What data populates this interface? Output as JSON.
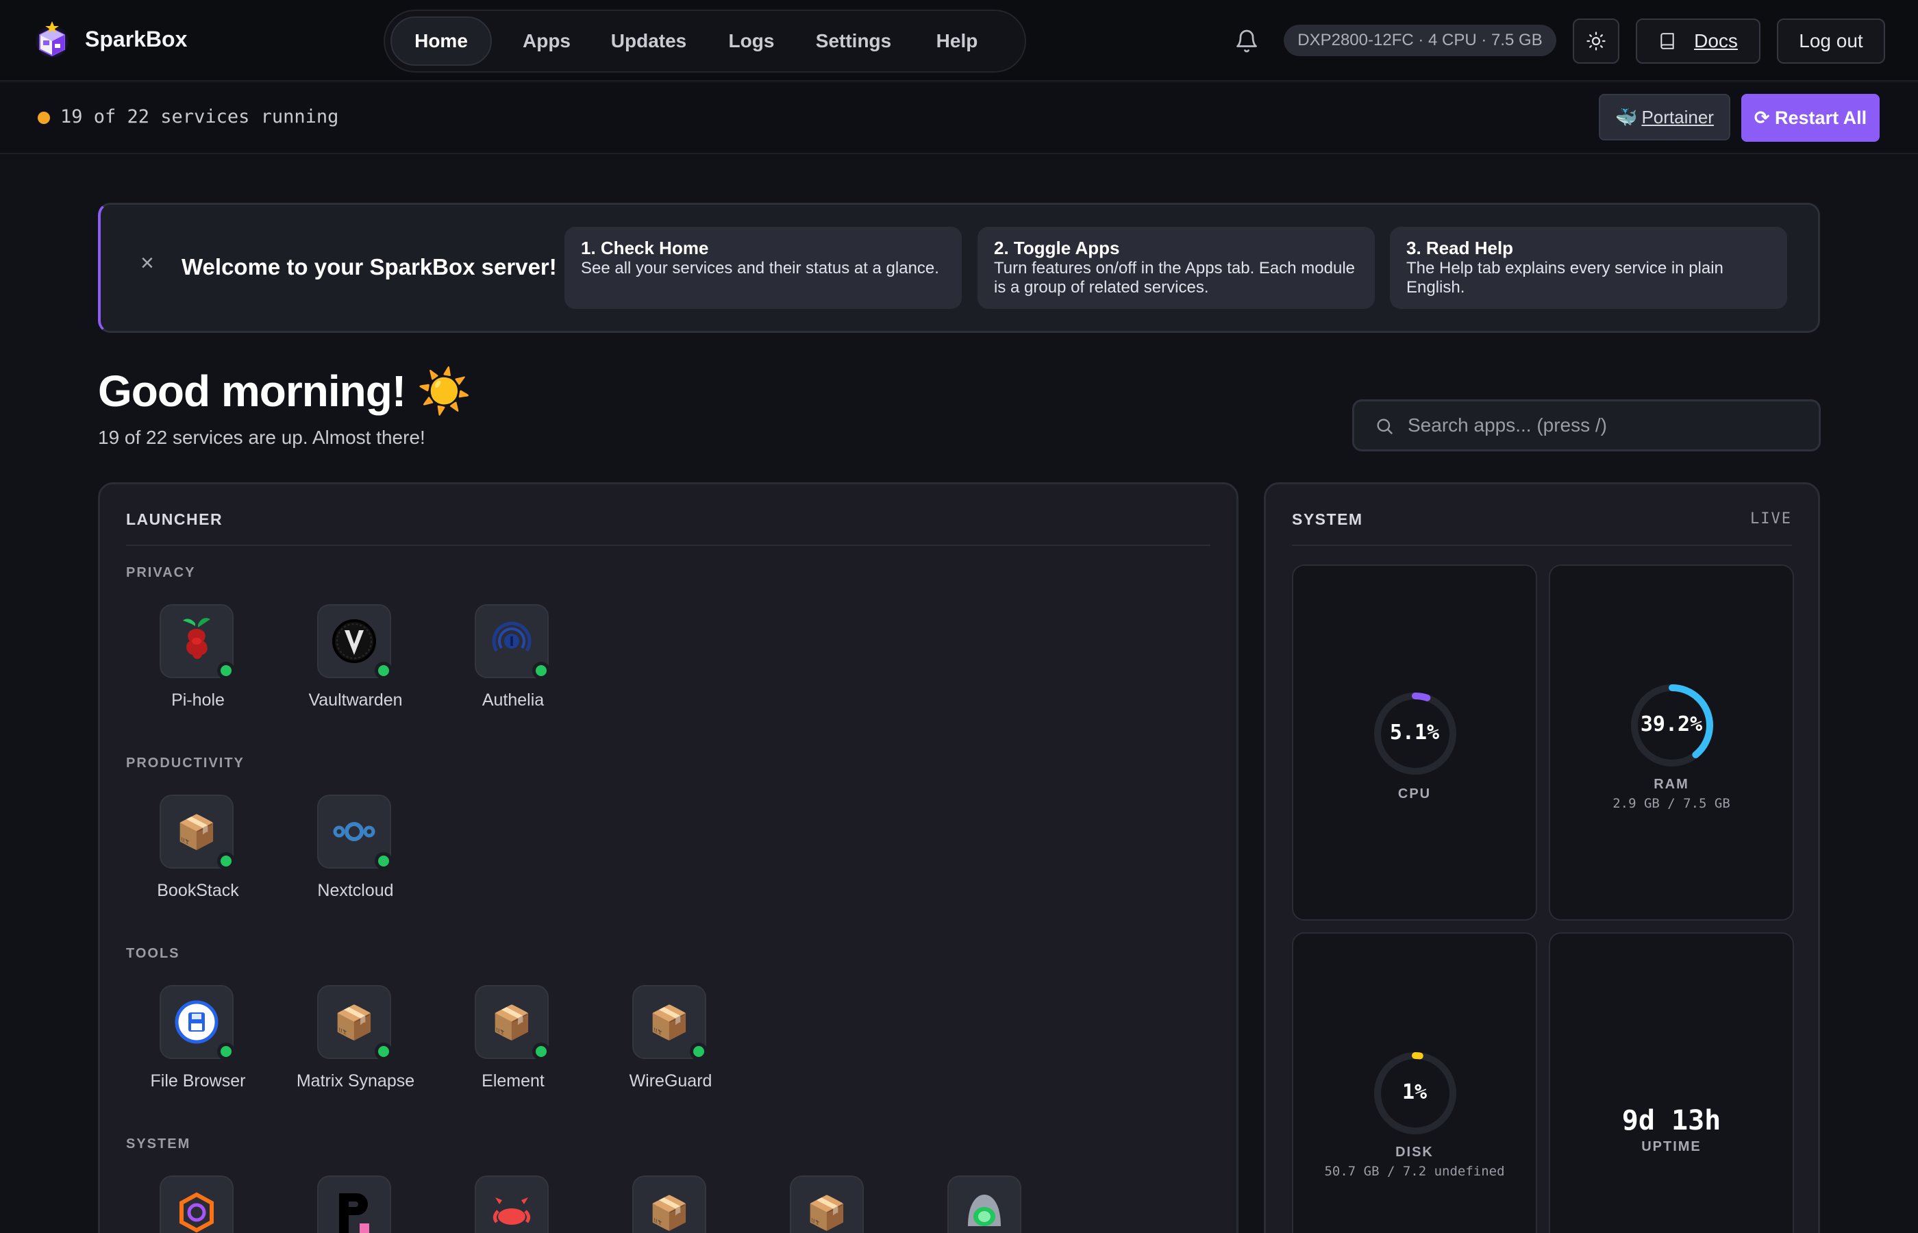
{
  "brand": {
    "name": "SparkBox",
    "logo_icon": "sparkbox-cube-icon"
  },
  "nav": {
    "tabs": [
      {
        "label": "Home",
        "active": true
      },
      {
        "label": "Apps",
        "active": false
      },
      {
        "label": "Updates",
        "active": false
      },
      {
        "label": "Logs",
        "active": false
      },
      {
        "label": "Settings",
        "active": false
      },
      {
        "label": "Help",
        "active": false
      }
    ],
    "host": "DXP2800-12FC · 4 CPU · 7.5 GB",
    "docs_label": "Docs",
    "logout_label": "Log out"
  },
  "statusbar": {
    "text": "19 of 22 services running",
    "dot_color": "#f5a524",
    "portainer_icon": "🐳",
    "portainer_label": "Portainer",
    "restart_label": "⟳ Restart All",
    "accent": "#8b5cf6"
  },
  "welcome": {
    "close": "×",
    "title": "Welcome to your SparkBox server!",
    "steps": [
      {
        "title": "1. Check Home",
        "body": "See all your services and their status at a glance."
      },
      {
        "title": "2. Toggle Apps",
        "body": "Turn features on/off in the Apps tab. Each module is a group of related services."
      },
      {
        "title": "3. Read Help",
        "body": "The Help tab explains every service in plain English."
      }
    ]
  },
  "greeting": {
    "title": "Good morning! ☀️",
    "subtitle": "19 of 22 services are up. Almost there!"
  },
  "search": {
    "placeholder": "Search apps... (press /)",
    "value": ""
  },
  "launcher": {
    "title": "LAUNCHER",
    "groups": [
      {
        "label": "PRIVACY",
        "apps": [
          {
            "name": "Pi-hole",
            "icon": "pihole-icon",
            "running": true
          },
          {
            "name": "Vaultwarden",
            "icon": "vaultwarden-icon",
            "running": true
          },
          {
            "name": "Authelia",
            "icon": "authelia-icon",
            "running": true
          }
        ]
      },
      {
        "label": "PRODUCTIVITY",
        "apps": [
          {
            "name": "BookStack",
            "icon": "package-icon",
            "glyph": "📦",
            "running": true
          },
          {
            "name": "Nextcloud",
            "icon": "nextcloud-icon",
            "running": true
          }
        ]
      },
      {
        "label": "TOOLS",
        "apps": [
          {
            "name": "File Browser",
            "icon": "file-browser-icon",
            "running": true
          },
          {
            "name": "Matrix Synapse",
            "icon": "package-icon",
            "glyph": "📦",
            "running": true
          },
          {
            "name": "Element",
            "icon": "package-icon",
            "glyph": "📦",
            "running": true
          },
          {
            "name": "WireGuard",
            "icon": "package-icon",
            "glyph": "📦",
            "running": true
          }
        ]
      },
      {
        "label": "SYSTEM",
        "apps": [
          {
            "name": "",
            "icon": "grafana-icon"
          },
          {
            "name": "",
            "icon": "pgadmin-icon"
          },
          {
            "name": "",
            "icon": "crab-icon"
          },
          {
            "name": "",
            "icon": "package-icon",
            "glyph": "📦"
          },
          {
            "name": "",
            "icon": "package-icon",
            "glyph": "📦"
          },
          {
            "name": "",
            "icon": "uptime-kuma-icon"
          }
        ]
      }
    ]
  },
  "system": {
    "title": "SYSTEM",
    "live": "LIVE",
    "cpu": {
      "value": "5.1%",
      "percent": 5.1,
      "label": "CPU",
      "color": "#8b5cf6"
    },
    "ram": {
      "value": "39.2%",
      "percent": 39.2,
      "label": "RAM",
      "detail": "2.9 GB / 7.5 GB",
      "color": "#38bdf8"
    },
    "disk": {
      "value": "1%",
      "percent": 1,
      "label": "DISK",
      "detail": "50.7 GB / 7.2 undefined",
      "color": "#facc15"
    },
    "uptime": {
      "value": "9d 13h",
      "label": "UPTIME"
    }
  }
}
